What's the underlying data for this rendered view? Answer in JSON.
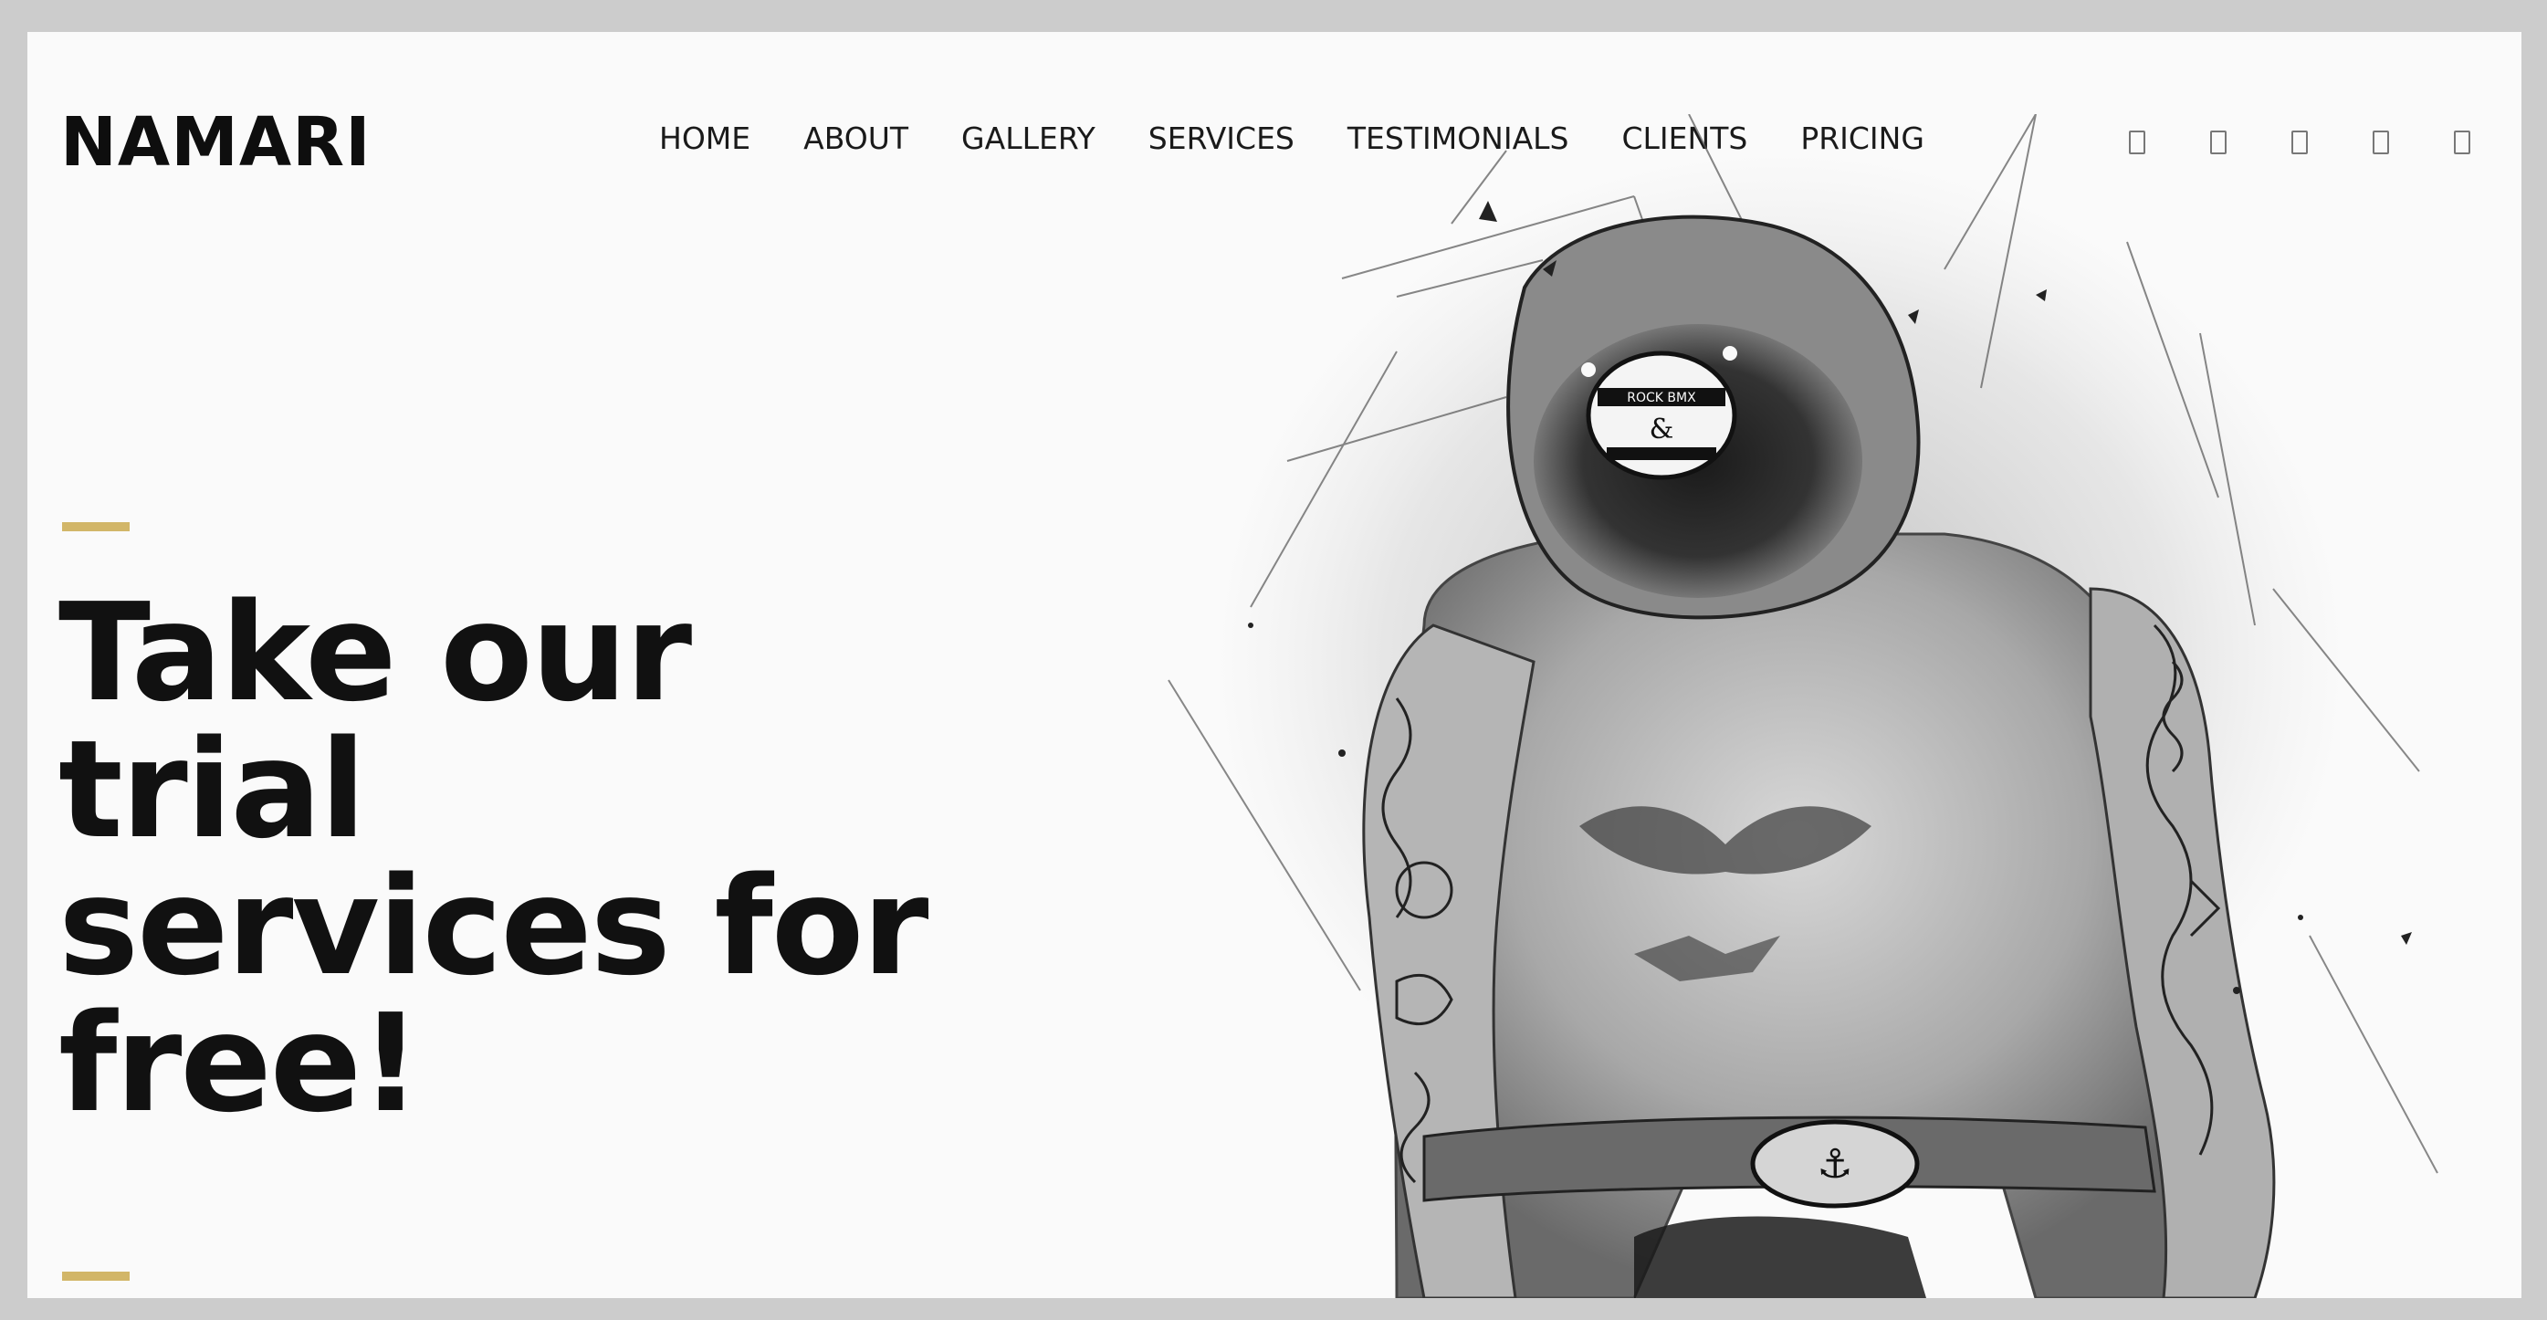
{
  "brand": {
    "logo": "NAMARI"
  },
  "nav": {
    "items": [
      "HOME",
      "ABOUT",
      "GALLERY",
      "SERVICES",
      "TESTIMONIALS",
      "CLIENTS",
      "PRICING"
    ]
  },
  "social": {
    "icons": [
      "social-icon-1",
      "social-icon-2",
      "social-icon-3",
      "social-icon-4",
      "social-icon-5"
    ]
  },
  "hero": {
    "line1": "Take our",
    "line2": "trial",
    "line3": "services for",
    "line4": "free!"
  },
  "illustration": {
    "cap_badge": "ROCK BMX",
    "buckle": "anchor"
  },
  "colors": {
    "accent": "#d2b668",
    "background": "#fafafa",
    "frame": "#cccccc",
    "text": "#111111"
  }
}
